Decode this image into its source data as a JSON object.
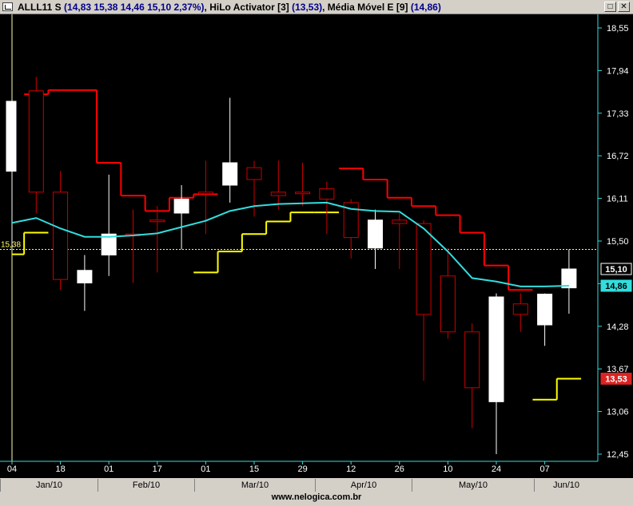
{
  "window": {
    "ticker": "ALLL11 S",
    "quote": "(14,83  15,38  14,46  15,10  2,37%)",
    "hilo_label": "HiLo Activator [3]",
    "hilo_value": "(13,53)",
    "mm_label": "Média Móvel E [9]",
    "mm_value": "(14,86)",
    "restore_label": "□",
    "close_label": "✕"
  },
  "price_axis": {
    "ticks": [
      "18,55",
      "17,94",
      "17,33",
      "16,72",
      "16,11",
      "15,50",
      "14,89",
      "14,28",
      "13,67",
      "13,06",
      "12,45"
    ],
    "last_price_label": "15,10",
    "mm_label": "14,86",
    "hilo_label": "13,53",
    "ref_line_label": "15,38"
  },
  "colors": {
    "background": "#000000",
    "up_candle": "#ffffff",
    "down_candle": "#cc0000",
    "hilo_high": "#ff0000",
    "hilo_low": "#ffff00",
    "ema": "#33dddd",
    "reference_line": "#ffff66",
    "axis": "#33dddd"
  },
  "time_axis": {
    "ticks": [
      "04",
      "18",
      "01",
      "17",
      "01",
      "15",
      "29",
      "12",
      "26",
      "10",
      "24",
      "07"
    ],
    "months": [
      "Jan/10",
      "Feb/10",
      "Mar/10",
      "Apr/10",
      "May/10",
      "Jun/10"
    ]
  },
  "watermark": "www.nelogica.com.br",
  "chart_data": {
    "type": "candlestick",
    "ylim": [
      12.3,
      18.7
    ],
    "reference_price": 15.38,
    "candles": [
      {
        "o": 16.5,
        "h": 17.5,
        "l": 15.35,
        "c": 17.5
      },
      {
        "o": 17.65,
        "h": 17.85,
        "l": 15.9,
        "c": 16.2
      },
      {
        "o": 16.2,
        "h": 16.5,
        "l": 14.8,
        "c": 14.95
      },
      {
        "o": 14.9,
        "h": 15.3,
        "l": 14.5,
        "c": 15.08
      },
      {
        "o": 15.3,
        "h": 16.45,
        "l": 15.0,
        "c": 15.6
      },
      {
        "o": 15.6,
        "h": 15.95,
        "l": 14.9,
        "c": 15.58
      },
      {
        "o": 15.8,
        "h": 16.0,
        "l": 15.05,
        "c": 15.78
      },
      {
        "o": 15.9,
        "h": 16.3,
        "l": 15.38,
        "c": 16.1
      },
      {
        "o": 16.2,
        "h": 16.65,
        "l": 15.6,
        "c": 16.18
      },
      {
        "o": 16.3,
        "h": 17.55,
        "l": 16.05,
        "c": 16.62
      },
      {
        "o": 16.55,
        "h": 16.65,
        "l": 15.85,
        "c": 16.38
      },
      {
        "o": 16.2,
        "h": 16.65,
        "l": 15.95,
        "c": 16.15
      },
      {
        "o": 16.2,
        "h": 16.62,
        "l": 16.0,
        "c": 16.18
      },
      {
        "o": 16.25,
        "h": 16.35,
        "l": 15.6,
        "c": 16.1
      },
      {
        "o": 16.05,
        "h": 16.1,
        "l": 15.25,
        "c": 15.55
      },
      {
        "o": 15.4,
        "h": 15.95,
        "l": 15.1,
        "c": 15.8
      },
      {
        "o": 15.8,
        "h": 15.9,
        "l": 15.1,
        "c": 15.75
      },
      {
        "o": 15.75,
        "h": 15.8,
        "l": 13.5,
        "c": 14.45
      },
      {
        "o": 15.0,
        "h": 15.4,
        "l": 14.1,
        "c": 14.2
      },
      {
        "o": 14.2,
        "h": 14.32,
        "l": 12.82,
        "c": 13.4
      },
      {
        "o": 13.2,
        "h": 14.75,
        "l": 12.45,
        "c": 14.7
      },
      {
        "o": 14.6,
        "h": 14.75,
        "l": 14.2,
        "c": 14.45
      },
      {
        "o": 14.3,
        "h": 14.75,
        "l": 14.0,
        "c": 14.74
      },
      {
        "o": 14.83,
        "h": 15.38,
        "l": 14.46,
        "c": 15.1
      }
    ],
    "hilo": [
      {
        "from": 1,
        "to": 2,
        "value": 17.6,
        "side": "high"
      },
      {
        "from": 2,
        "to": 4,
        "value": 17.66,
        "side": "high"
      },
      {
        "from": 4,
        "to": 5,
        "value": 16.62,
        "side": "high"
      },
      {
        "from": 5,
        "to": 6,
        "value": 16.15,
        "side": "high"
      },
      {
        "from": 6,
        "to": 7,
        "value": 15.93,
        "side": "high"
      },
      {
        "from": 7,
        "to": 8,
        "value": 16.12,
        "side": "high"
      },
      {
        "from": 8,
        "to": 9,
        "value": 16.17,
        "side": "high"
      },
      {
        "from": 14,
        "to": 15,
        "value": 16.54,
        "side": "high"
      },
      {
        "from": 15,
        "to": 16,
        "value": 16.38,
        "side": "high"
      },
      {
        "from": 16,
        "to": 17,
        "value": 16.12,
        "side": "high"
      },
      {
        "from": 17,
        "to": 18,
        "value": 16.0,
        "side": "high"
      },
      {
        "from": 18,
        "to": 19,
        "value": 15.87,
        "side": "high"
      },
      {
        "from": 19,
        "to": 20,
        "value": 15.62,
        "side": "high"
      },
      {
        "from": 20,
        "to": 21,
        "value": 15.15,
        "side": "high"
      },
      {
        "from": 21,
        "to": 22,
        "value": 14.8,
        "side": "high"
      },
      {
        "from": 0,
        "to": 1,
        "value": 15.31,
        "side": "low"
      },
      {
        "from": 1,
        "to": 2,
        "value": 15.62,
        "side": "low"
      },
      {
        "from": 8,
        "to": 9,
        "value": 15.05,
        "side": "low"
      },
      {
        "from": 9,
        "to": 10,
        "value": 15.35,
        "side": "low"
      },
      {
        "from": 10,
        "to": 11,
        "value": 15.6,
        "side": "low"
      },
      {
        "from": 11,
        "to": 12,
        "value": 15.78,
        "side": "low"
      },
      {
        "from": 12,
        "to": 13,
        "value": 15.91,
        "side": "low"
      },
      {
        "from": 13,
        "to": 14,
        "value": 15.91,
        "side": "low"
      },
      {
        "from": 22,
        "to": 23,
        "value": 13.23,
        "side": "low"
      },
      {
        "from": 23,
        "to": 24,
        "value": 13.53,
        "side": "low"
      }
    ],
    "ema": [
      15.76,
      15.83,
      15.68,
      15.56,
      15.56,
      15.58,
      15.61,
      15.7,
      15.79,
      15.93,
      16.0,
      16.03,
      16.04,
      16.05,
      15.96,
      15.93,
      15.92,
      15.68,
      15.35,
      14.97,
      14.92,
      14.85,
      14.85,
      14.86
    ]
  }
}
